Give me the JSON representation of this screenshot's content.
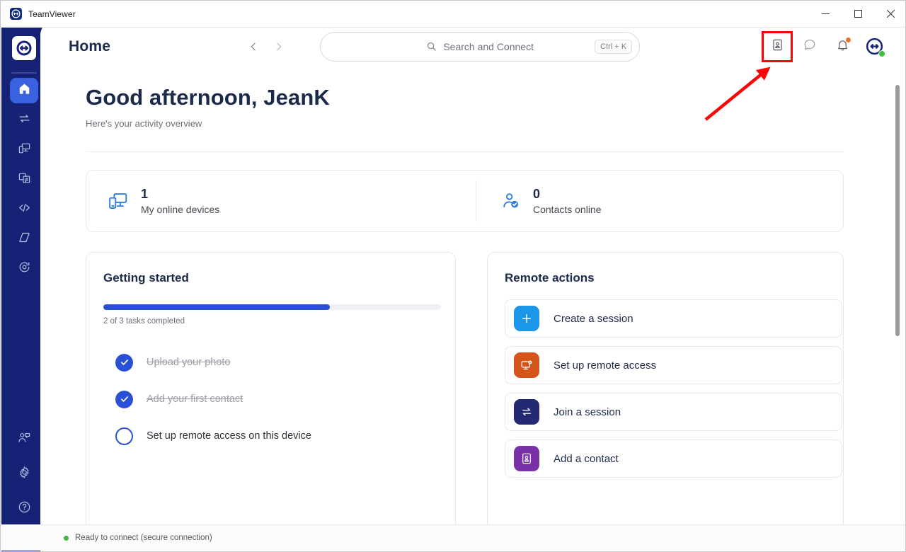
{
  "window": {
    "app_title": "TeamViewer",
    "logo_icon": "teamviewer-logo-icon",
    "minimize_label": "–",
    "maximize_label": "□",
    "close_label": "✕"
  },
  "sidebar": {
    "logo_icon": "teamviewer-logo-icon",
    "items": [
      {
        "name": "home",
        "icon": "home-icon",
        "active": true
      },
      {
        "name": "remote-control",
        "icon": "transfer-arrows-icon",
        "active": false
      },
      {
        "name": "devices",
        "icon": "devices-icon",
        "active": false
      },
      {
        "name": "file-transfer",
        "icon": "file-transfer-icon",
        "active": false
      },
      {
        "name": "scripts",
        "icon": "code-brackets-icon",
        "active": false
      },
      {
        "name": "augmented-reality",
        "icon": "diamond-icon",
        "active": false
      },
      {
        "name": "monitoring",
        "icon": "scan-circle-icon",
        "active": false
      }
    ],
    "bottom_items": [
      {
        "name": "contacts-chat",
        "icon": "contacts-chat-icon"
      },
      {
        "name": "settings",
        "icon": "gear-icon"
      },
      {
        "name": "help",
        "icon": "question-circle-icon"
      }
    ]
  },
  "topbar": {
    "page_title": "Home",
    "back_icon": "chevron-left-icon",
    "forward_icon": "chevron-right-icon",
    "search": {
      "icon": "search-icon",
      "placeholder": "Search and Connect",
      "shortcut": "Ctrl + K"
    },
    "icons": [
      {
        "name": "contacts-book-icon",
        "highlighted": true
      },
      {
        "name": "chat-bubble-icon",
        "highlighted": false
      },
      {
        "name": "bell-icon",
        "highlighted": false,
        "has_notification": true
      },
      {
        "name": "account-avatar-icon",
        "highlighted": false,
        "status": "online"
      }
    ]
  },
  "content": {
    "greeting": "Good afternoon, JeanK",
    "subgreeting": "Here's your activity overview",
    "stats": [
      {
        "value": "1",
        "label": "My online devices",
        "icon": "devices-icon"
      },
      {
        "value": "0",
        "label": "Contacts online",
        "icon": "contact-check-icon"
      }
    ],
    "getting_started": {
      "title": "Getting started",
      "progress_percent": 67,
      "progress_label": "2 of 3 tasks completed",
      "tasks": [
        {
          "label": "Upload your photo",
          "done": true,
          "icon": "check-icon"
        },
        {
          "label": "Add your first contact",
          "done": true,
          "icon": "check-icon"
        },
        {
          "label": "Set up remote access on this device",
          "done": false,
          "icon": "empty-circle-icon"
        }
      ]
    },
    "remote_actions": {
      "title": "Remote actions",
      "items": [
        {
          "label": "Create a session",
          "icon": "plus-icon",
          "color": "#1c96e8"
        },
        {
          "label": "Set up remote access",
          "icon": "monitor-gear-icon",
          "color": "#d4551a"
        },
        {
          "label": "Join a session",
          "icon": "transfer-arrows-icon",
          "color": "#232a72"
        },
        {
          "label": "Add a contact",
          "icon": "contacts-book-icon",
          "color": "#7а31a8"
        }
      ]
    }
  },
  "statusbar": {
    "text": "Ready to connect (secure connection)",
    "indicator_color": "#3eb83e"
  },
  "annotation": {
    "highlight_color": "#fb0606",
    "arrow_icon": "arrow-pointer-icon"
  }
}
